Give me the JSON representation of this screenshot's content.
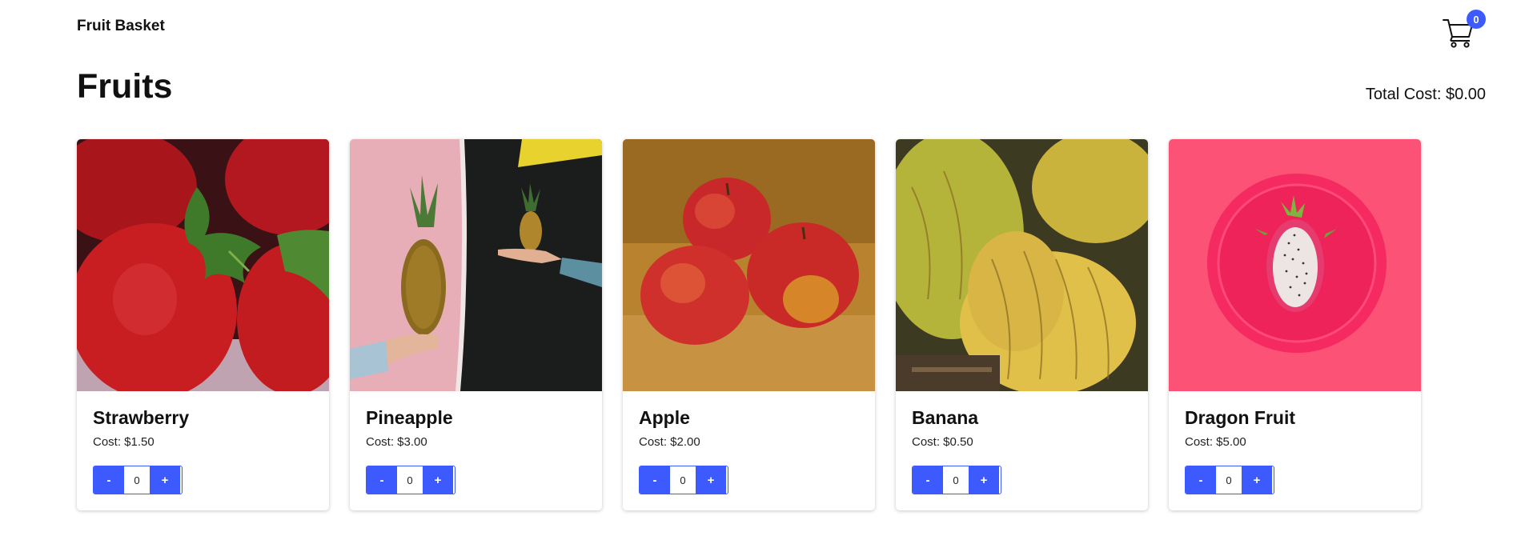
{
  "header": {
    "brand": "Fruit Basket",
    "cart_icon": "shopping-cart-icon",
    "cart_count": "0"
  },
  "main": {
    "title": "Fruits",
    "total_cost": "Total Cost: $0.00"
  },
  "colors": {
    "accent": "#3d5afe"
  },
  "products": [
    {
      "name": "Strawberry",
      "cost": "Cost: $1.50",
      "minus": "-",
      "plus": "+",
      "quantity": "0"
    },
    {
      "name": "Pineapple",
      "cost": "Cost: $3.00",
      "minus": "-",
      "plus": "+",
      "quantity": "0"
    },
    {
      "name": "Apple",
      "cost": "Cost: $2.00",
      "minus": "-",
      "plus": "+",
      "quantity": "0"
    },
    {
      "name": "Banana",
      "cost": "Cost: $0.50",
      "minus": "-",
      "plus": "+",
      "quantity": "0"
    },
    {
      "name": "Dragon Fruit",
      "cost": "Cost: $5.00",
      "minus": "-",
      "plus": "+",
      "quantity": "0"
    }
  ]
}
